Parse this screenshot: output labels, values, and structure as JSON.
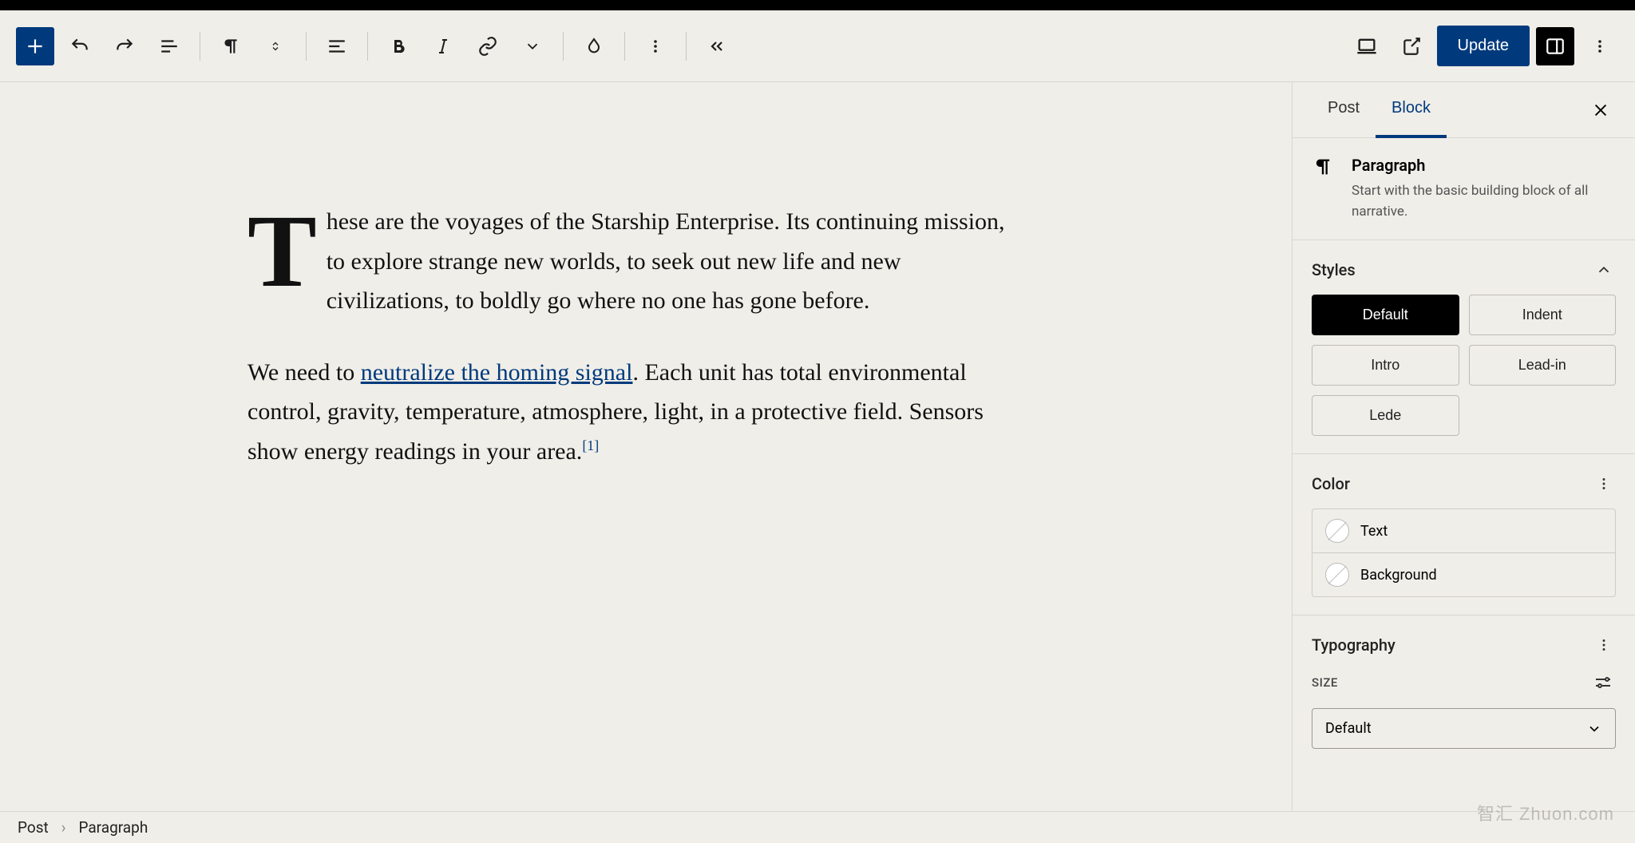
{
  "toolbar": {
    "update_label": "Update"
  },
  "sidebar": {
    "tabs": {
      "post": "Post",
      "block": "Block"
    },
    "block_info": {
      "title": "Paragraph",
      "desc": "Start with the basic building block of all narrative."
    },
    "styles": {
      "title": "Styles",
      "options": [
        "Default",
        "Indent",
        "Intro",
        "Lead-in",
        "Lede"
      ]
    },
    "color": {
      "title": "Color",
      "items": {
        "text": "Text",
        "background": "Background"
      }
    },
    "typography": {
      "title": "Typography",
      "size_label": "SIZE",
      "size_value": "Default"
    }
  },
  "content": {
    "p1": "These are the voyages of the Starship Enterprise. Its continuing mission, to explore strange new worlds, to seek out new life and new civilizations, to boldly go where no one has gone before.",
    "p2_pre": "We need to ",
    "p2_link": "neutralize the homing signal",
    "p2_post": ". Each unit has total environmental control, gravity, temperature, atmosphere, light, in a protective field. Sensors show energy readings in your area.",
    "p2_footnote": "[1]"
  },
  "breadcrumb": {
    "root": "Post",
    "current": "Paragraph"
  },
  "watermark": "智汇 Zhuon.com"
}
